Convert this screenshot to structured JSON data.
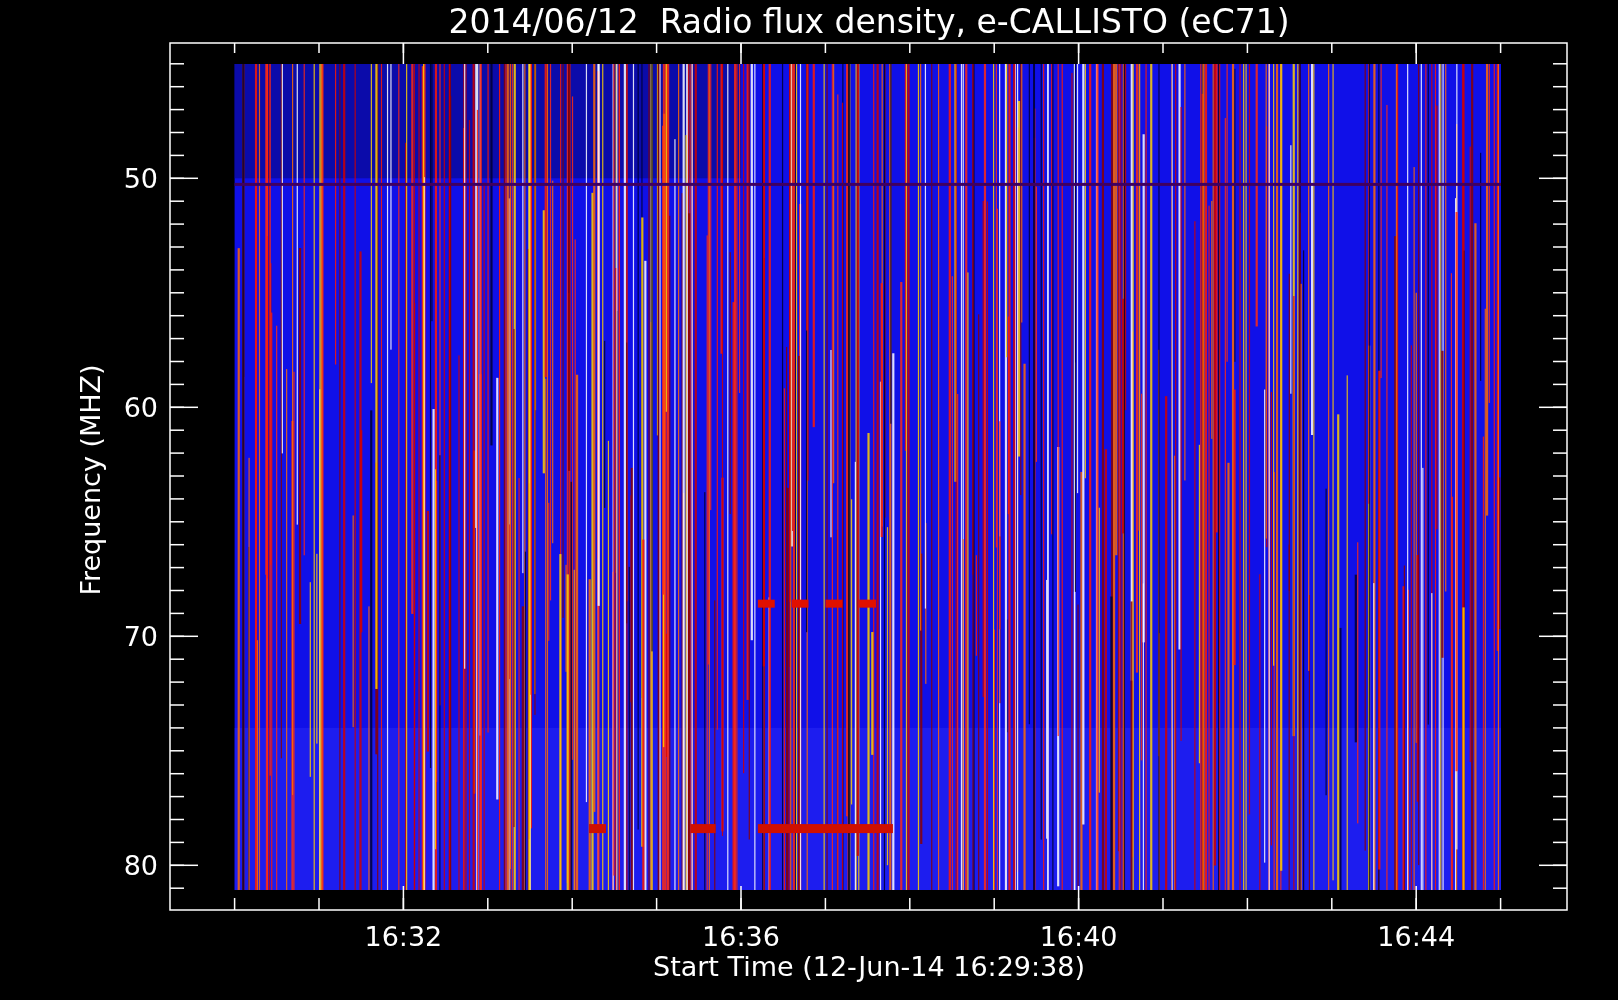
{
  "title": "2014/06/12  Radio flux density, e-CALLISTO (eC71)",
  "y_axis": {
    "label": "Frequency (MHZ)",
    "ticks": [
      "50",
      "60",
      "70",
      "80"
    ]
  },
  "x_axis": {
    "label": "Start Time (12-Jun-14 16:29:38)",
    "ticks": [
      "16:32",
      "16:36",
      "16:40",
      "16:44"
    ]
  }
}
